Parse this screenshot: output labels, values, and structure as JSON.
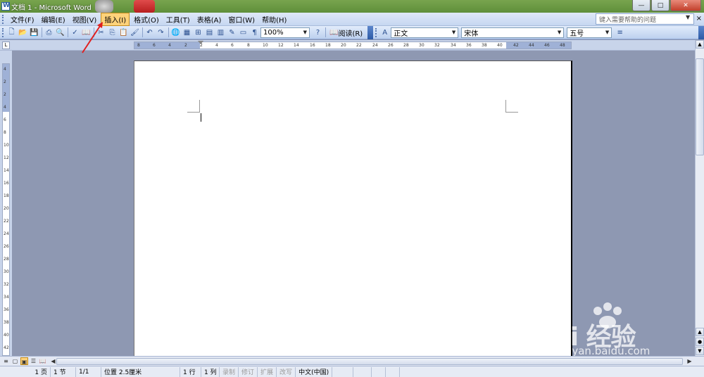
{
  "window": {
    "title": "文档 1 - Microsoft Word"
  },
  "menubar": {
    "items": [
      {
        "label": "文件(F)",
        "active": false
      },
      {
        "label": "编辑(E)",
        "active": false
      },
      {
        "label": "视图(V)",
        "active": false
      },
      {
        "label": "插入(I)",
        "active": true
      },
      {
        "label": "格式(O)",
        "active": false
      },
      {
        "label": "工具(T)",
        "active": false
      },
      {
        "label": "表格(A)",
        "active": false
      },
      {
        "label": "窗口(W)",
        "active": false
      },
      {
        "label": "帮助(H)",
        "active": false
      }
    ],
    "help_placeholder": "键入需要帮助的问题",
    "close_glyph": "×"
  },
  "toolbar": {
    "zoom": "100%",
    "read_label": "阅读(R)",
    "style": "正文",
    "font": "宋体",
    "size": "五号",
    "icons": [
      "new-icon",
      "open-icon",
      "save-icon",
      "print-icon",
      "print-preview-icon",
      "spelling-icon",
      "research-icon",
      "cut-icon",
      "copy-icon",
      "paste-icon",
      "format-painter-icon",
      "undo-icon",
      "redo-icon",
      "hyperlink-icon",
      "tables-borders-icon",
      "insert-table-icon",
      "insert-excel-icon",
      "columns-icon",
      "drawing-icon",
      "document-map-icon",
      "show-hide-icon",
      "help-icon",
      "style-icon",
      "align-icon"
    ]
  },
  "ruler": {
    "corner_glyph": "L",
    "h_ticks": [
      "8",
      "6",
      "4",
      "2",
      "2",
      "4",
      "6",
      "8",
      "10",
      "12",
      "14",
      "16",
      "18",
      "20",
      "22",
      "24",
      "26",
      "28",
      "30",
      "32",
      "34",
      "36",
      "38",
      "40",
      "42",
      "44",
      "46",
      "48"
    ],
    "v_ticks": [
      "4",
      "2",
      "2",
      "4",
      "6",
      "8",
      "10",
      "12",
      "14",
      "16",
      "18",
      "20",
      "22",
      "24",
      "26",
      "28",
      "30",
      "32",
      "34",
      "36",
      "38",
      "40",
      "42"
    ]
  },
  "statusbar": {
    "page": "1 页",
    "section": "1 节",
    "page_of": "1/1",
    "position": "位置 2.5厘米",
    "line": "1 行",
    "col": "1 列",
    "rec": "录制",
    "trk": "修订",
    "ext": "扩展",
    "ovr": "改写",
    "language": "中文(中国)"
  },
  "watermark": {
    "brand": "Bai 经验",
    "url": "jingyan.baidu.com"
  },
  "colors": {
    "title_bar": "#6a9a44",
    "menu_bg": "#d2e0f5",
    "doc_bg": "#8e98b2",
    "active_menu": "#ffd27a",
    "annotation_arrow": "#e02020"
  }
}
